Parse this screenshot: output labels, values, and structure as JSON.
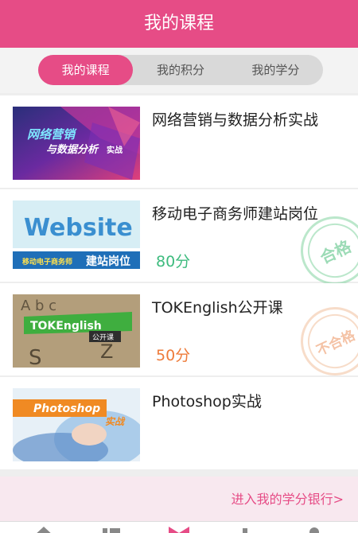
{
  "header": {
    "title": "我的课程"
  },
  "tabs": [
    "我的课程",
    "我的积分",
    "我的学分"
  ],
  "courses": [
    {
      "title": "网络营销与数据分析实战",
      "thumb_text_1": "网络营销",
      "thumb_text_2": "与数据分析",
      "thumb_text_3": "实战"
    },
    {
      "title": "移动电子商务师建站岗位",
      "score": "80分",
      "stamp": "合格",
      "thumb_text_1": "Website",
      "thumb_text_2": "移动电子商务师",
      "thumb_text_3": "建站岗位"
    },
    {
      "title": "TOKEnglish公开课",
      "score": "50分",
      "stamp": "不合格",
      "thumb_text_1": "TOKEnglish",
      "thumb_text_2": "公开课"
    },
    {
      "title": "Photoshop实战",
      "thumb_text_1": "Photoshop",
      "thumb_text_2": "实战"
    }
  ],
  "bank_link": "进入我的学分银行>",
  "colors": {
    "primary": "#e64c86",
    "pass": "#3dbb7e",
    "fail": "#ee7b3a"
  },
  "tab_icons": [
    "home-icon",
    "list-icon",
    "bookmark-icon",
    "money-icon",
    "user-icon"
  ]
}
